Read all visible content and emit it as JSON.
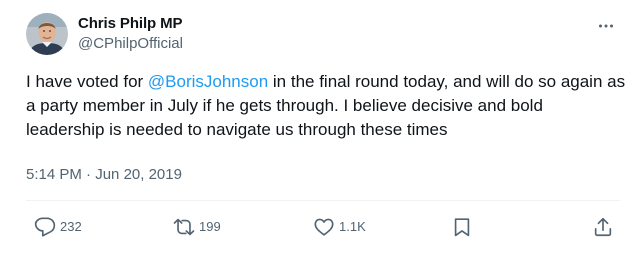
{
  "tweet": {
    "author_name": "Chris Philp MP",
    "author_handle": "@CPhilpOfficial",
    "text_part1": "I have voted for ",
    "mention": "@BorisJohnson",
    "text_part2": " in the final round today, and will do so again as a party member in July if he gets through. I believe decisive and bold leadership is needed to navigate us through these times",
    "time": "5:14 PM",
    "separator": " · ",
    "date": "Jun 20, 2019"
  },
  "actions": {
    "replies": "232",
    "reposts": "199",
    "likes": "1.1K"
  },
  "colors": {
    "mention": "#1d9bf0",
    "secondary_text": "#536471",
    "primary_text": "#0f1419"
  },
  "icons": {
    "more": "more-icon",
    "reply": "reply-icon",
    "repost": "repost-icon",
    "like": "heart-icon",
    "bookmark": "bookmark-icon",
    "share": "share-icon"
  }
}
